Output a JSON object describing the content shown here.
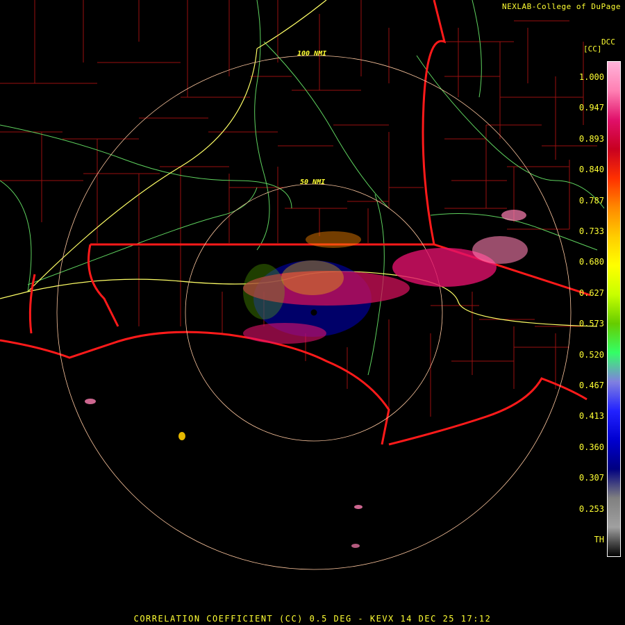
{
  "header": {
    "credit": "NEXLAB-College of DuPage",
    "station_tag": "DCC",
    "unit": "[CC]"
  },
  "caption": "CORRELATION COEFFICIENT (CC) 0.5 DEG - KEVX 14 DEC 25 17:12",
  "range_rings": [
    {
      "label": "50 NMI"
    },
    {
      "label": "100 NMI"
    }
  ],
  "legend": {
    "ticks": [
      "1.000",
      "0.947",
      "0.893",
      "0.840",
      "0.787",
      "0.733",
      "0.680",
      "0.627",
      "0.573",
      "0.520",
      "0.467",
      "0.413",
      "0.360",
      "0.307",
      "0.253",
      "TH"
    ],
    "stops": [
      "#ffb3d9",
      "#ff80b3",
      "#e0106a",
      "#c80020",
      "#ff3000",
      "#ff8800",
      "#ffcc00",
      "#ffff00",
      "#c8ff00",
      "#66cc00",
      "#33ff66",
      "#8080e0",
      "#2222ff",
      "#0000d0",
      "#000080",
      "#808080",
      "#a0a0a0",
      "#000000"
    ]
  },
  "colors": {
    "state_border": "#ff1a1a",
    "county_line": "#a01010",
    "highway": "#ffff66",
    "road": "#5fd35f",
    "ring": "#ffc8a0"
  },
  "icons": [
    "radar-site-icon"
  ]
}
